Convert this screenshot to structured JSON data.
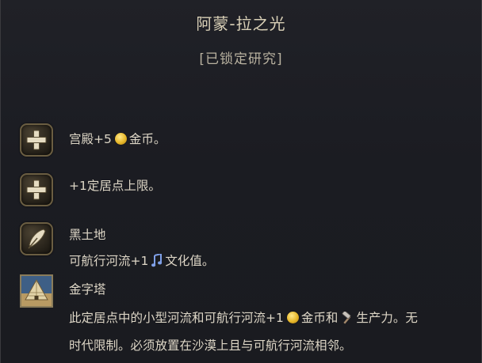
{
  "tooltip": {
    "title": "阿蒙-拉之光",
    "subtitle": "[已锁定研究]",
    "effects": [
      {
        "icon": "plus-icon",
        "line1_pre": "宫殿+5",
        "line1_resource": "gold-coin-icon",
        "line1_post": "金币。"
      },
      {
        "icon": "plus-icon",
        "line1": "+1定居点上限。"
      },
      {
        "icon": "feather-quill-icon",
        "heading": "黑土地",
        "line_pre": "可航行河流+1",
        "line_resource": "culture-note-icon",
        "line_post": "文化值。"
      },
      {
        "icon": "pyramid-icon",
        "heading": "金字塔",
        "line_a_pre": "此定居点中的小型河流和可航行河流+1",
        "line_a_resource1": "gold-coin-icon",
        "line_a_mid": "金币和",
        "line_a_resource2": "hammer-production-icon",
        "line_a_post": "生产力。无",
        "line_b": "时代限制。必须放置在沙漠上且与可航行河流相邻。"
      }
    ]
  },
  "colors": {
    "background": "#1c1d23",
    "title_text": "#d8cfb6",
    "body_text": "#ddd6c6",
    "gold_coin": "#e7b72a",
    "culture_note": "#7fa0e8",
    "icon_border": "#6b5e42"
  }
}
